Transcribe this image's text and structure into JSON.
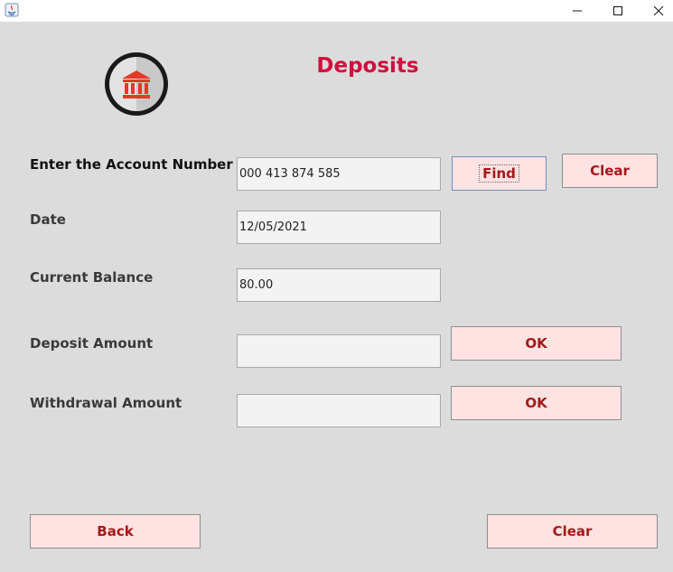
{
  "titlebar": {
    "icons": {
      "app": "java-icon",
      "minimize": "minimize-icon",
      "maximize": "maximize-icon",
      "close": "close-icon"
    }
  },
  "header": {
    "logo_icon": "bank-icon",
    "title": "Deposits"
  },
  "form": {
    "account_number": {
      "label": "Enter the Account Number",
      "value": "000 413 874 585"
    },
    "date": {
      "label": "Date",
      "value": "12/05/2021"
    },
    "current_balance": {
      "label": "Current Balance",
      "value": "80.00"
    },
    "deposit_amount": {
      "label": "Deposit Amount",
      "value": ""
    },
    "withdrawal_amount": {
      "label": "Withdrawal Amount",
      "value": ""
    }
  },
  "buttons": {
    "find": "Find",
    "clear_top": "Clear",
    "deposit_ok": "OK",
    "withdrawal_ok": "OK",
    "back": "Back",
    "clear_bottom": "Clear"
  },
  "colors": {
    "title": "#d01040",
    "button_bg": "#ffe2e2",
    "button_text": "#a31a1a",
    "window_bg": "#dcdcdc"
  }
}
